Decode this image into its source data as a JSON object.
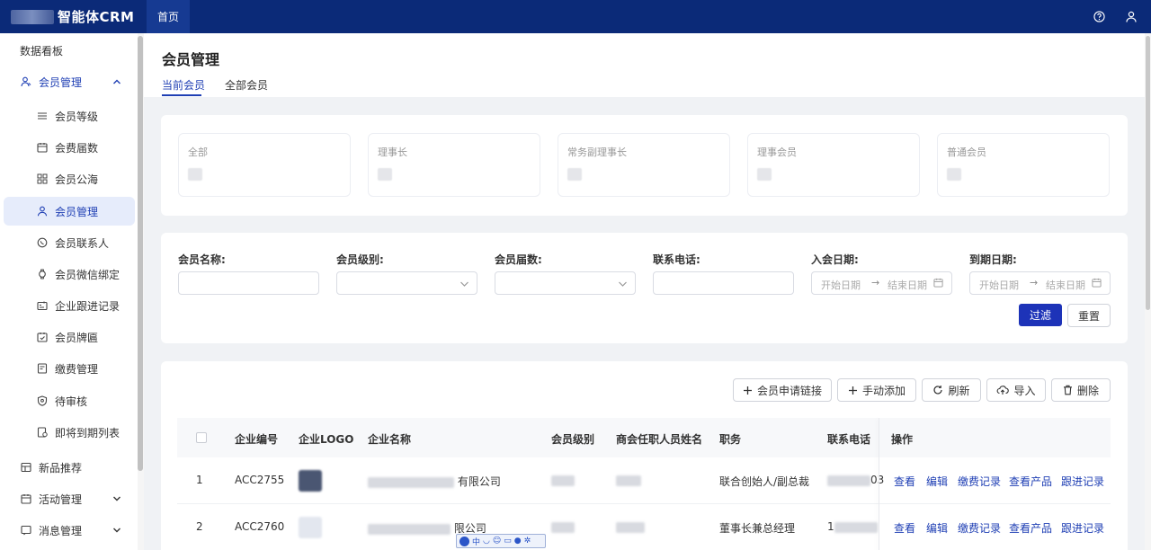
{
  "topbar": {
    "brand_title": "智能体CRM",
    "tab_home": "首页",
    "icons": [
      "help-icon",
      "user-icon"
    ]
  },
  "sidebar": {
    "items": [
      {
        "label": "数据看板",
        "level": "top"
      },
      {
        "label": "会员管理",
        "level": "top",
        "expanded": true,
        "icon": "members-icon"
      },
      {
        "label": "会员等级",
        "level": "sub",
        "icon": "list-icon"
      },
      {
        "label": "会费届数",
        "level": "sub",
        "icon": "calendar-icon"
      },
      {
        "label": "会员公海",
        "level": "sub",
        "icon": "grid-icon"
      },
      {
        "label": "会员管理",
        "level": "sub",
        "icon": "user-icon",
        "selected": true
      },
      {
        "label": "会员联系人",
        "level": "sub",
        "icon": "whatsapp-icon"
      },
      {
        "label": "会员微信绑定",
        "level": "sub",
        "icon": "watch-icon"
      },
      {
        "label": "企业跟进记录",
        "level": "sub",
        "icon": "records-icon"
      },
      {
        "label": "会员牌匾",
        "level": "sub",
        "icon": "calendar-check-icon"
      },
      {
        "label": "缴费管理",
        "level": "sub",
        "icon": "payment-icon"
      },
      {
        "label": "待审核",
        "level": "sub",
        "icon": "shield-icon"
      },
      {
        "label": "即将到期列表",
        "level": "sub",
        "icon": "expiry-icon"
      },
      {
        "label": "新品推荐",
        "level": "top",
        "icon": "product-icon"
      },
      {
        "label": "活动管理",
        "level": "top",
        "icon": "calendar-icon",
        "collapsed": true
      },
      {
        "label": "消息管理",
        "level": "top",
        "icon": "message-icon",
        "collapsed": true
      }
    ]
  },
  "page": {
    "title": "会员管理",
    "tabs": [
      "当前会员",
      "全部会员"
    ]
  },
  "stats": [
    {
      "label": "全部"
    },
    {
      "label": "理事长"
    },
    {
      "label": "常务副理事长"
    },
    {
      "label": "理事会员"
    },
    {
      "label": "普通会员"
    }
  ],
  "filters": {
    "name_label": "会员名称:",
    "level_label": "会员级别:",
    "term_label": "会员届数:",
    "phone_label": "联系电话:",
    "join_label": "入会日期:",
    "expire_label": "到期日期:",
    "start_placeholder": "开始日期",
    "end_placeholder": "结束日期",
    "arrow": "→",
    "filter_button": "过滤",
    "reset_button": "重置"
  },
  "toolbar": {
    "apply_link": "会员申请链接",
    "manual_add": "手动添加",
    "refresh": "刷新",
    "import": "导入",
    "delete": "删除"
  },
  "table": {
    "columns": [
      "企业编号",
      "企业LOGO",
      "企业名称",
      "会员级别",
      "商会任职人员姓名",
      "职务",
      "联系电话",
      "操作"
    ],
    "actions": [
      "查看",
      "编辑",
      "缴费记录",
      "查看产品",
      "跟进记录"
    ],
    "rows": [
      {
        "index": "1",
        "code": "ACC2755",
        "name_suffix": "有限公司",
        "position": "联合创始人/副总裁",
        "phone_suffix": "03"
      },
      {
        "index": "2",
        "code": "ACC2760",
        "name_suffix": "限公司",
        "position": "董事长兼总经理",
        "phone_prefix": "1"
      }
    ]
  },
  "colors": {
    "topbar": "#0b2a78",
    "accent": "#1f3fb4",
    "primary_button": "#1d33b8"
  }
}
